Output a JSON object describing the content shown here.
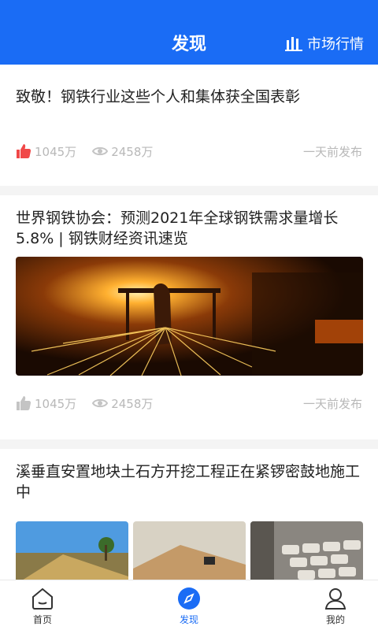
{
  "header": {
    "title": "发现",
    "market_label": "市场行情",
    "market_icon": "bar-chart-icon",
    "bg_color": "#1a6cf5"
  },
  "articles": [
    {
      "title": "致敬！钢铁行业这些个人和集体获全国表彰",
      "likes": "1045万",
      "views": "2458万",
      "published": "一天前发布",
      "liked": true
    },
    {
      "title": "世界钢铁协会：预测2021年全球钢铁需求量增长5.8% | 钢铁财经资讯速览",
      "likes": "1045万",
      "views": "2458万",
      "published": "一天前发布",
      "liked": false,
      "image": "steel-mill-sparks-photo"
    },
    {
      "title": "溪垂直安置地块土石方开挖工程正在紧锣密鼓地施工中",
      "images": [
        "sand-pile-photo",
        "construction-site-photo",
        "cement-bags-photo"
      ]
    }
  ],
  "tabbar": {
    "home": "首页",
    "discover": "发现",
    "mine": "我的",
    "active_color": "#1a6cf5"
  }
}
